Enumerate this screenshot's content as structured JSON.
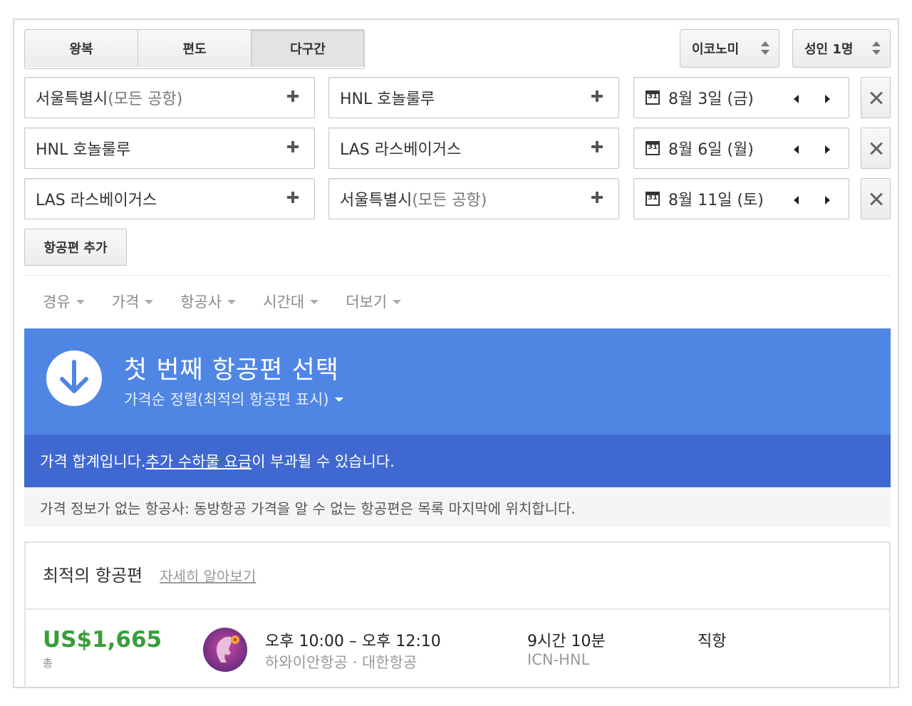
{
  "trip_type": {
    "options": [
      "왕복",
      "편도",
      "다구간"
    ],
    "selected": "다구간"
  },
  "cabin": {
    "label": "이코노미"
  },
  "passengers": {
    "label": "성인 1명"
  },
  "legs": [
    {
      "origin": {
        "main": "서울특별시",
        "sub": " (모든 공항)"
      },
      "destination": {
        "main": "HNL 호놀룰루",
        "sub": ""
      },
      "date": "8월 3일 (금)"
    },
    {
      "origin": {
        "main": "HNL 호놀룰루",
        "sub": ""
      },
      "destination": {
        "main": "LAS 라스베이거스",
        "sub": ""
      },
      "date": "8월 6일 (월)"
    },
    {
      "origin": {
        "main": "LAS 라스베이거스",
        "sub": ""
      },
      "destination": {
        "main": "서울특별시",
        "sub": " (모든 공항)"
      },
      "date": "8월 11일 (토)"
    }
  ],
  "calendar_day": "31",
  "add_flight_label": "항공편 추가",
  "filters": [
    "경유",
    "가격",
    "항공사",
    "시간대",
    "더보기"
  ],
  "banner": {
    "title": "첫 번째 항공편 선택",
    "sort_label": "가격순 정렬(최적의 항공편 표시)",
    "color": "#4f86e4"
  },
  "notice": {
    "before": "가격 합계입니다. ",
    "link": "추가 수하물 요금",
    "after": "이 부과될 수 있습니다.",
    "color": "#3f69d0"
  },
  "info_text": "가격 정보가 없는 항공사: 동방항공 가격을 알 수 없는 항공편은 목록 마지막에 위치합니다.",
  "results": {
    "heading": "최적의 항공편",
    "learn_more": "자세히 알아보기",
    "flights": [
      {
        "price": "US$1,665",
        "price_label": "총",
        "times": "오후 10:00 – 오후 12:10",
        "airlines": "하와이안항공 · 대한항공",
        "duration": "9시간 10분",
        "route": "ICN-HNL",
        "stops": "직항",
        "logo_icon": "hawaiian-airlines-logo",
        "price_color": "#3a9d3c"
      }
    ]
  }
}
